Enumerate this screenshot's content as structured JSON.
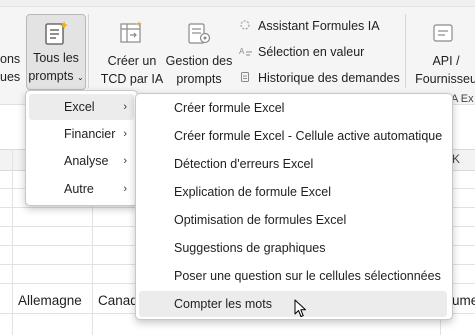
{
  "ribbon": {
    "left_partial_line1": "ons",
    "left_partial_line2": "ues",
    "all_prompts": {
      "line1": "Tous les",
      "line2": "prompts",
      "chevron": "chevron-down-icon"
    },
    "create_pivot": {
      "line1": "Créer un",
      "line2": "TCD par IA"
    },
    "manage_prompts": {
      "line1": "Gestion des",
      "line2": "prompts"
    },
    "small_items": [
      {
        "label": "Assistant Formules IA",
        "icon": "formula-assistant-icon"
      },
      {
        "label": "Sélection en valeur",
        "icon": "value-selection-icon"
      },
      {
        "label": "Historique des demandes",
        "icon": "history-icon"
      }
    ],
    "api": {
      "line1": "API /",
      "line2": "Fournisseu"
    },
    "group_label_partial": "A Ex"
  },
  "sheet": {
    "column_header_partial": "K",
    "cells": [
      {
        "text": "Allemagne"
      },
      {
        "text": "Canad"
      },
      {
        "text": "ume"
      }
    ]
  },
  "menu_primary": {
    "items": [
      {
        "label": "Excel",
        "has_submenu": true,
        "active": true
      },
      {
        "label": "Financier",
        "has_submenu": true,
        "active": false
      },
      {
        "label": "Analyse",
        "has_submenu": true,
        "active": false
      },
      {
        "label": "Autre",
        "has_submenu": true,
        "active": false
      }
    ],
    "chevron_glyph": "›"
  },
  "menu_excel": {
    "items": [
      {
        "label": "Créer formule Excel"
      },
      {
        "label": "Créer formule Excel - Cellule active automatique"
      },
      {
        "label": "Détection d'erreurs Excel"
      },
      {
        "label": "Explication de formule Excel"
      },
      {
        "label": "Optimisation de formules Excel"
      },
      {
        "label": "Suggestions de graphiques"
      },
      {
        "label": "Poser une question sur le cellules sélectionnées"
      },
      {
        "label": "Compter les mots",
        "hovered": true
      }
    ]
  },
  "cursor": {
    "icon": "mouse-pointer-icon"
  }
}
